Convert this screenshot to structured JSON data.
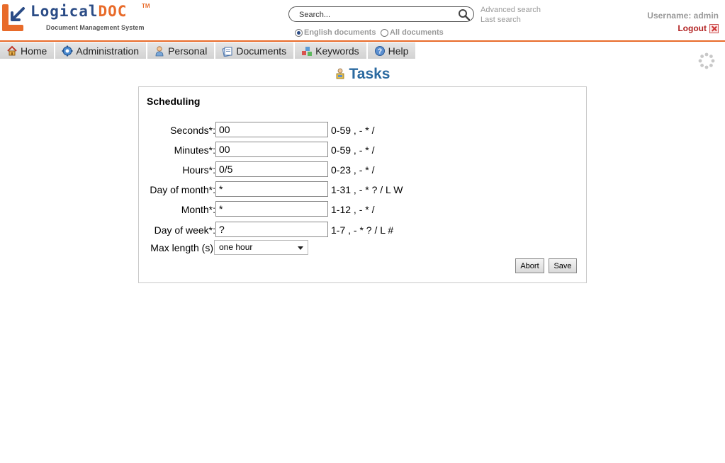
{
  "header": {
    "logo": {
      "brand_main": "Logical",
      "brand_accent": "DOC",
      "tm": "TM",
      "tagline": "Document Management System"
    },
    "search": {
      "placeholder": "Search..."
    },
    "links": {
      "advanced_search": "Advanced search",
      "last_search": "Last search"
    },
    "languages": [
      {
        "label": "English documents",
        "selected": true
      },
      {
        "label": "All documents",
        "selected": false
      }
    ],
    "username": "Username: admin",
    "logout": "Logout"
  },
  "menu": {
    "items": [
      {
        "label": "Home",
        "icon": "home-icon"
      },
      {
        "label": "Administration",
        "icon": "gear-icon"
      },
      {
        "label": "Personal",
        "icon": "person-icon"
      },
      {
        "label": "Documents",
        "icon": "documents-icon"
      },
      {
        "label": "Keywords",
        "icon": "keywords-icon"
      },
      {
        "label": "Help",
        "icon": "help-icon"
      }
    ]
  },
  "page": {
    "title": "Tasks",
    "title_icon": "tasks-icon"
  },
  "scheduling": {
    "title": "Scheduling",
    "fields": [
      {
        "label": "Seconds*:",
        "value": "00",
        "hint": "0-59 , - * /"
      },
      {
        "label": "Minutes*:",
        "value": "00",
        "hint": "0-59 , - * /"
      },
      {
        "label": "Hours*:",
        "value": "0/5",
        "hint": "0-23 , - * /"
      },
      {
        "label": "Day of month*:",
        "value": "*",
        "hint": "1-31 , - * ? / L W"
      },
      {
        "label": "Month*:",
        "value": "*",
        "hint": "1-12 , - * /"
      },
      {
        "label": "Day of week*:",
        "value": "?",
        "hint": "1-7 , - * ? / L #"
      }
    ],
    "max_length": {
      "label": "Max length (s)",
      "selected": "one hour"
    },
    "buttons": {
      "abort": "Abort",
      "save": "Save"
    }
  },
  "colors": {
    "accent_orange": "#e86b2a",
    "brand_blue": "#2b4c86",
    "title_blue": "#2b6aa0",
    "logout_red": "#b22222"
  }
}
